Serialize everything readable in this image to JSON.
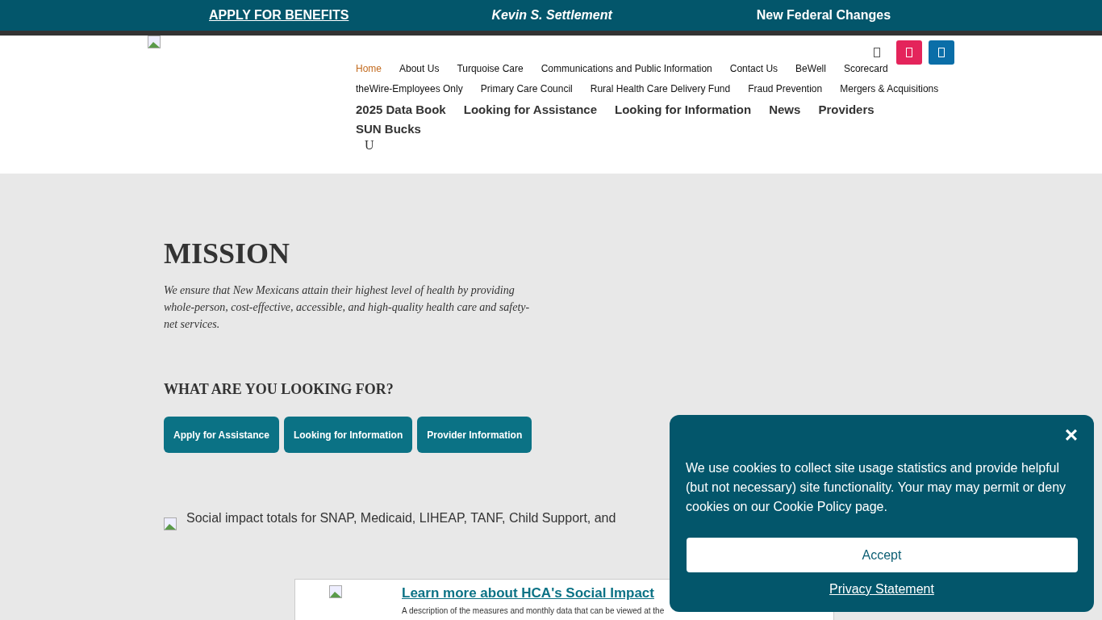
{
  "top_bar": [
    {
      "label": "APPLY FOR BENEFITS",
      "kind": "underline"
    },
    {
      "label": "Kevin S. Settlement",
      "kind": "italic"
    },
    {
      "label": "New Federal Changes",
      "kind": "plain"
    }
  ],
  "social_buttons": [
    {
      "kind": "plain"
    },
    {
      "kind": "pink"
    },
    {
      "kind": "blue"
    }
  ],
  "nav_primary": [
    {
      "label": "Home",
      "selected": true
    },
    {
      "label": "About Us",
      "selected": false
    },
    {
      "label": "Turquoise Care",
      "selected": false
    },
    {
      "label": "Communications and Public Information",
      "selected": false
    },
    {
      "label": "Contact Us",
      "selected": false
    },
    {
      "label": "BeWell",
      "selected": false
    },
    {
      "label": "Scorecard",
      "selected": false
    }
  ],
  "nav_secondary": [
    "theWire-Employees Only",
    "Primary Care Council",
    "Rural Health Care Delivery Fund",
    "Fraud Prevention",
    "Mergers & Acquisitions"
  ],
  "nav_main": [
    "2025 Data Book",
    "Looking for Assistance",
    "Looking for Information",
    "News",
    "Providers",
    "SUN Bucks"
  ],
  "nav_toggle": "U",
  "mission": {
    "title": "MISSION",
    "text": "We ensure that New Mexicans attain their highest level of health by providing whole-person, cost-effective, accessible, and high-quality health care and safety-net services."
  },
  "looking_for": {
    "title": "WHAT ARE YOU LOOKING FOR?",
    "buttons": [
      "Apply for Assistance",
      "Looking for Information",
      "Provider Information"
    ]
  },
  "impact_image_alt": "Social impact totals for SNAP, Medicaid, LIHEAP, TANF, Child Support, and",
  "scorecard_card": {
    "link": "Learn more about HCA's Social Impact",
    "text": "A description of the measures and monthly data that can be viewed at the"
  },
  "cookie_banner": {
    "close": "×",
    "text": "We use cookies to collect site usage statistics and provide helpful (but not necessary) site functionality. Your may may permit or deny cookies on our Cookie Policy page.",
    "accept": "Accept",
    "privacy_link": "Privacy Statement"
  }
}
